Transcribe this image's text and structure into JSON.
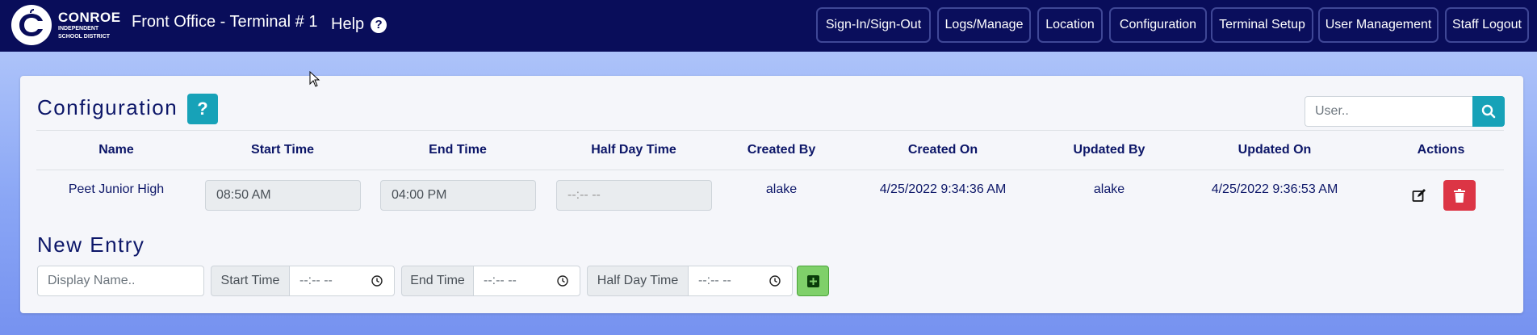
{
  "logo": {
    "name": "CONROE",
    "subline1": "INDEPENDENT",
    "subline2": "SCHOOL DISTRICT"
  },
  "header": {
    "title": "Front Office - Terminal # 1",
    "help_label": "Help",
    "help_icon": "question-circle-icon"
  },
  "nav": [
    {
      "label": "Sign-In/Sign-Out"
    },
    {
      "label": "Logs/Manage"
    },
    {
      "label": "Location"
    },
    {
      "label": "Configuration"
    },
    {
      "label": "Terminal Setup"
    },
    {
      "label": "User Management"
    },
    {
      "label": "Staff Logout"
    }
  ],
  "page": {
    "title": "Configuration",
    "help_button_label": "?",
    "search": {
      "placeholder": "User..",
      "icon": "search-icon"
    }
  },
  "table": {
    "columns": [
      "Name",
      "Start Time",
      "End Time",
      "Half Day Time",
      "Created By",
      "Created On",
      "Updated By",
      "Updated On",
      "Actions"
    ],
    "rows": [
      {
        "name": "Peet Junior High",
        "start_time": "08:50 AM",
        "end_time": "04:00 PM",
        "half_day_time": "--:-- --",
        "created_by": "alake",
        "created_on": "4/25/2022 9:34:36 AM",
        "updated_by": "alake",
        "updated_on": "4/25/2022 9:36:53 AM"
      }
    ]
  },
  "new_entry": {
    "title": "New Entry",
    "display_name_placeholder": "Display Name..",
    "start_time_label": "Start Time",
    "end_time_label": "End Time",
    "half_day_time_label": "Half Day Time",
    "time_placeholder": "--:-- --"
  },
  "colors": {
    "navbar": "#090d5a",
    "accent": "#17a2b8",
    "danger": "#dc3545",
    "success": "#7fd06a",
    "text": "#0c1668"
  }
}
